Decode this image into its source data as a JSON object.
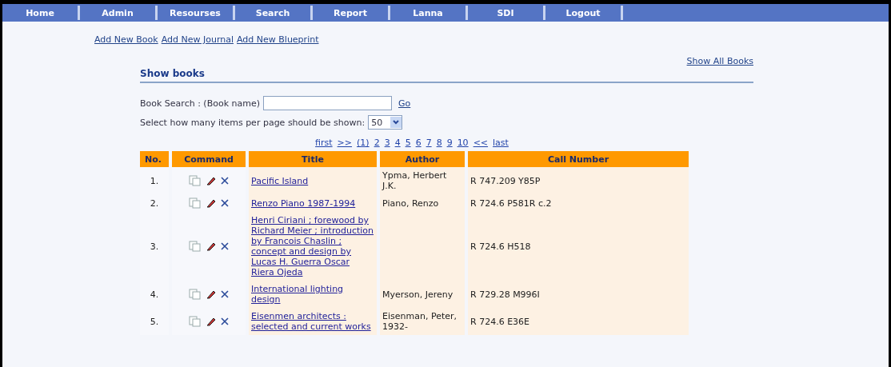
{
  "nav": [
    "Home",
    "Admin",
    "Resourses",
    "Search",
    "Report",
    "Lanna",
    "SDI",
    "Logout"
  ],
  "add_links": [
    "Add New Book",
    "Add New Journal",
    "Add New Blueprint"
  ],
  "show_all_link": "Show All Books",
  "section_title": "Show books",
  "search": {
    "label": "Book Search : (Book name)",
    "button": "Go"
  },
  "per_page": {
    "label": "Select how many items per page should be shown:",
    "value": "50"
  },
  "pagination": [
    "first",
    ">>",
    "(1)",
    "2",
    "3",
    "4",
    "5",
    "6",
    "7",
    "8",
    "9",
    "10",
    "<<",
    "last"
  ],
  "table": {
    "columns": [
      "No.",
      "Command",
      "Title",
      "Author",
      "Call Number"
    ],
    "rows": [
      {
        "no": "1.",
        "title": "Pacific Island",
        "author": "Ypma, Herbert J.K.",
        "call_number": "R 747.209 Y85P"
      },
      {
        "no": "2.",
        "title": "Renzo Piano 1987-1994",
        "author": "Piano, Renzo",
        "call_number": "R 724.6 P581R c.2"
      },
      {
        "no": "3.",
        "title": "Henri Ciriani ; forewood by Richard Meier ; introduction by Francois Chaslin ; concept and design by Lucas H. Guerra Oscar Riera Ojeda",
        "call_number": "R 724.6 H518"
      },
      {
        "no": "4.",
        "title": "International lighting design",
        "author": "Myerson, Jereny",
        "call_number": "R 729.28 M996I"
      },
      {
        "no": "5.",
        "title": "Eisenmen architects : selected and current works",
        "author": "Eisenman, Peter, 1932-",
        "call_number": "R 724.6 E36E"
      }
    ]
  }
}
